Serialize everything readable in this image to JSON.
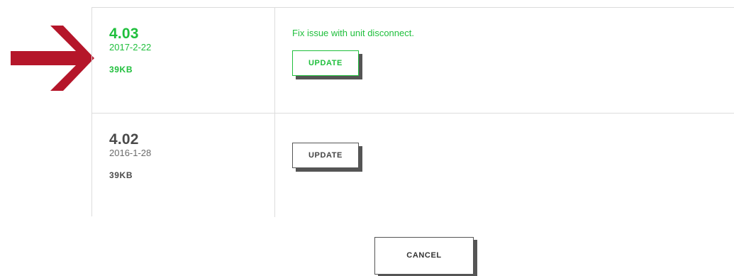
{
  "firmware_versions": [
    {
      "version": "4.03",
      "date": "2017-2-22",
      "size": "39KB",
      "release_note": "Fix issue with unit disconnect.",
      "update_label": "UPDATE",
      "highlight_color": "#1fbf3c"
    },
    {
      "version": "4.02",
      "date": "2016-1-28",
      "size": "39KB",
      "release_note": "",
      "update_label": "UPDATE"
    }
  ],
  "cancel_label": "CANCEL",
  "annotation": {
    "arrow_color": "#b5162a",
    "icon": "arrow-right-icon"
  }
}
